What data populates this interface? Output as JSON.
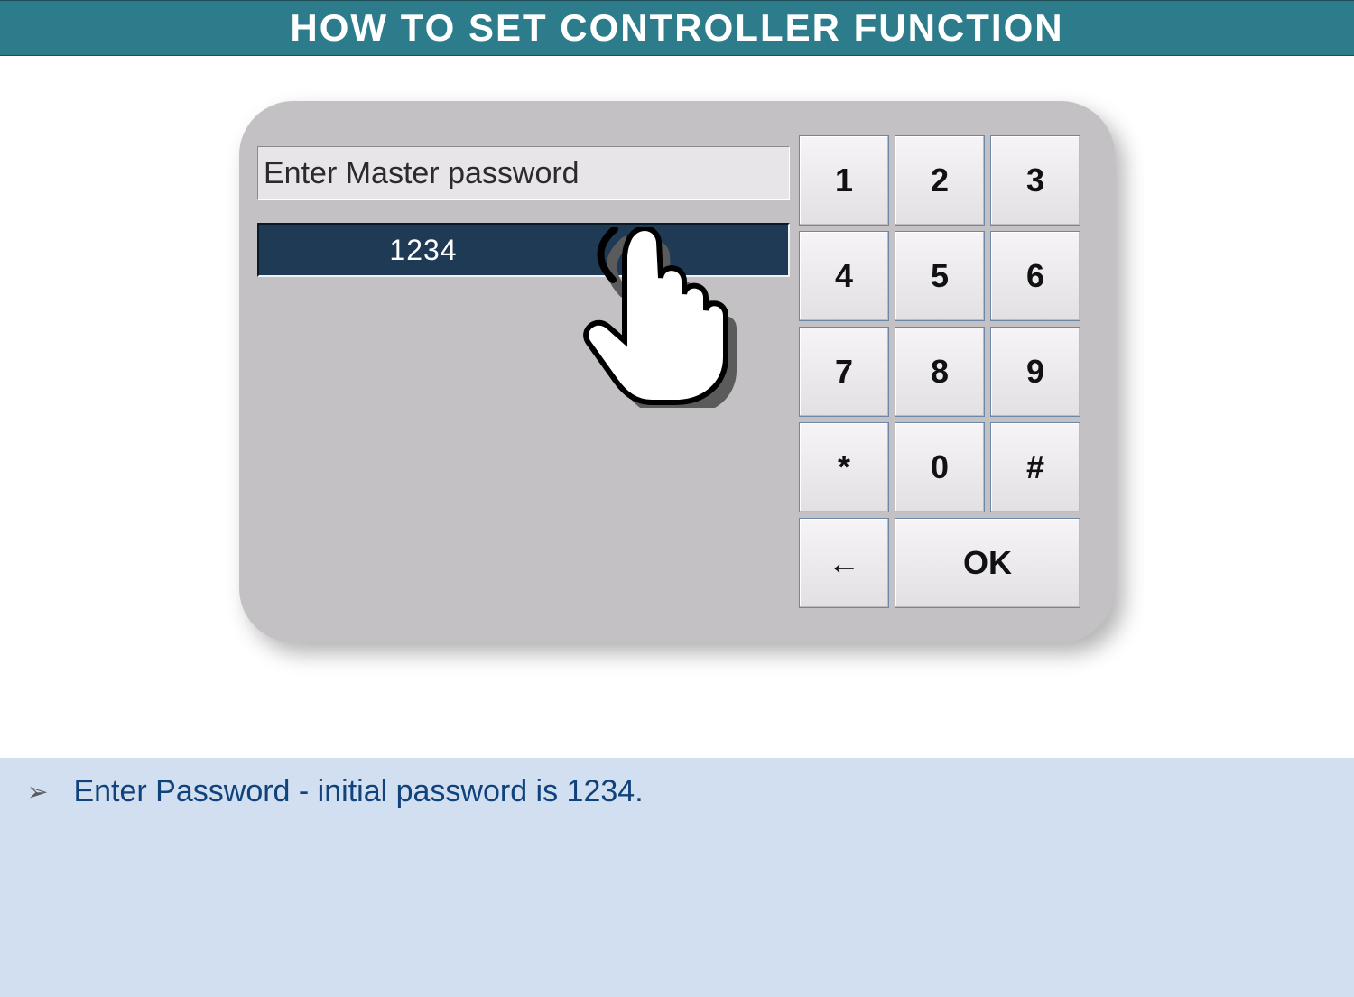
{
  "title": "HOW TO SET CONTROLLER FUNCTION",
  "panel": {
    "prompt": "Enter Master password",
    "password_value": "1234"
  },
  "keypad": {
    "keys": [
      "1",
      "2",
      "3",
      "4",
      "5",
      "6",
      "7",
      "8",
      "9",
      "*",
      "0",
      "#"
    ],
    "back": "←",
    "ok": "OK"
  },
  "instruction": {
    "bullet": "➢",
    "text": "Enter Password -  initial password is 1234."
  }
}
